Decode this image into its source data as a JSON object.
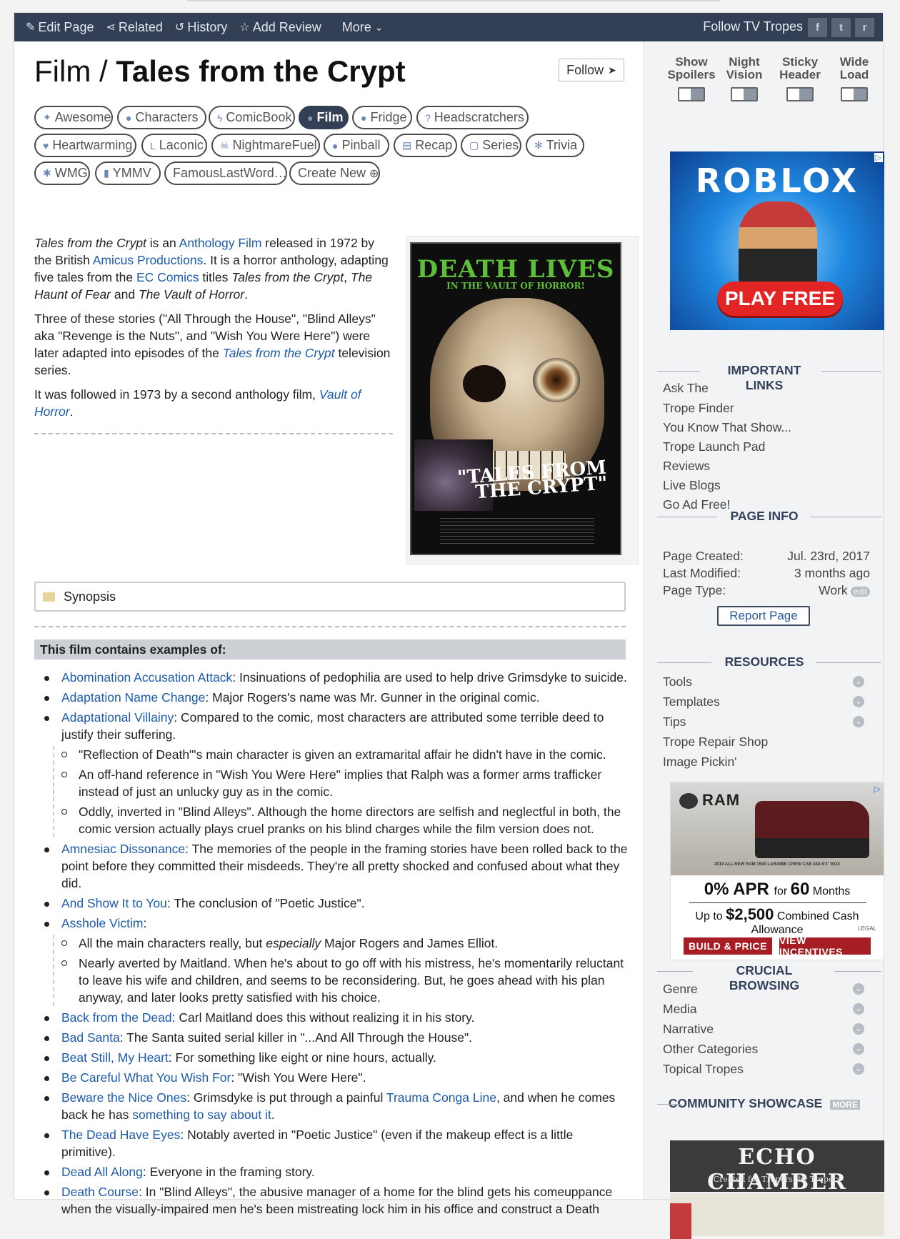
{
  "topbar": {
    "nav": [
      {
        "icon": "pencil-icon",
        "glyph": "✎",
        "label": "Edit Page"
      },
      {
        "icon": "share-icon",
        "glyph": "⋖",
        "label": "Related"
      },
      {
        "icon": "history-icon",
        "glyph": "↺",
        "label": "History"
      },
      {
        "icon": "star-icon",
        "glyph": "☆",
        "label": "Add Review"
      }
    ],
    "more_label": "More",
    "follow_label": "Follow TV Tropes",
    "social": [
      {
        "icon": "facebook-icon",
        "glyph": "f"
      },
      {
        "icon": "twitter-icon",
        "glyph": "t"
      },
      {
        "icon": "reddit-icon",
        "glyph": "r"
      }
    ]
  },
  "page": {
    "category": "Film",
    "separator": " / ",
    "title": "Tales from the Crypt",
    "follow_button": "Follow"
  },
  "tabs": [
    {
      "label": "Awesome",
      "glyph": "✦",
      "icon": "trophy-icon"
    },
    {
      "label": "Characters",
      "glyph": "●",
      "icon": "characters-icon"
    },
    {
      "label": "ComicBook",
      "glyph": "ϟ",
      "icon": "lightning-icon"
    },
    {
      "label": "Film",
      "glyph": "●",
      "icon": "film-icon",
      "active": true
    },
    {
      "label": "Fridge",
      "glyph": "●",
      "icon": "lightbulb-icon"
    },
    {
      "label": "Headscratchers",
      "glyph": "?",
      "icon": "question-icon"
    },
    {
      "label": "Heartwarming",
      "glyph": "♥",
      "icon": "heart-icon"
    },
    {
      "label": "Laconic",
      "glyph": "L",
      "icon": "laconic-icon"
    },
    {
      "label": "NightmareFuel",
      "glyph": "☠",
      "icon": "skull-icon"
    },
    {
      "label": "Pinball",
      "glyph": "●",
      "icon": "pinball-icon"
    },
    {
      "label": "Recap",
      "glyph": "▤",
      "icon": "recap-icon"
    },
    {
      "label": "Series",
      "glyph": "▢",
      "icon": "tv-icon"
    },
    {
      "label": "Trivia",
      "glyph": "✻",
      "icon": "trivia-icon"
    },
    {
      "label": "WMG",
      "glyph": "✱",
      "icon": "wmg-icon"
    },
    {
      "label": "YMMV",
      "glyph": "▮",
      "icon": "ymmv-icon"
    },
    {
      "label": "FamousLastWord…",
      "glyph": "",
      "icon": ""
    },
    {
      "label": "Create New",
      "glyph": "⊕",
      "icon": "plus-circle-icon"
    }
  ],
  "intro": {
    "p1": {
      "a": "Tales from the Crypt",
      "b": " is an ",
      "c": "Anthology Film",
      "d": " released in 1972 by the British ",
      "e": "Amicus Productions",
      "f": ". It is a horror anthology, adapting five tales from the ",
      "g": "EC Comics",
      "h": " titles ",
      "i": "Tales from the Crypt",
      "j": ", ",
      "k": "The Haunt of Fear",
      "l": " and ",
      "m": "The Vault of Horror",
      "n": "."
    },
    "p2": {
      "a": "Three of these stories (\"All Through the House\", \"Blind Alleys\" aka \"Revenge is the Nuts\", and \"Wish You Were Here\") were later adapted into episodes of the ",
      "b": "Tales from the Crypt",
      "c": " television series."
    },
    "p3": {
      "a": "It was followed in 1973 by a second anthology film, ",
      "b": "Vault of Horror",
      "c": "."
    }
  },
  "poster": {
    "headline": "DEATH LIVES",
    "subline": "IN THE VAULT OF HORROR!",
    "title_art": "\"TALES FROM THE CRYPT\""
  },
  "synopsis_label": "Synopsis",
  "examples_heading": "This film contains examples of:",
  "tropes": [
    {
      "link": "Abomination Accusation Attack",
      "text": ": Insinuations of pedophilia are used to help drive Grimsdyke to suicide."
    },
    {
      "link": "Adaptation Name Change",
      "text": ": Major Rogers's name was Mr. Gunner in the original comic."
    },
    {
      "link": "Adaptational Villainy",
      "text": ": Compared to the comic, most characters are attributed some terrible deed to justify their suffering.",
      "sub": [
        "\"Reflection of Death\"'s main character is given an extramarital affair he didn't have in the comic.",
        "An off-hand reference in \"Wish You Were Here\" implies that Ralph was a former arms trafficker instead of just an unlucky guy as in the comic.",
        "Oddly, inverted in \"Blind Alleys\". Although the home directors are selfish and neglectful in both, the comic version actually plays cruel pranks on his blind charges while the film version does not."
      ]
    },
    {
      "link": "Amnesiac Dissonance",
      "text": ": The memories of the people in the framing stories have been rolled back to the point before they committed their misdeeds. They're all pretty shocked and confused about what they did."
    },
    {
      "link": "And Show It to You",
      "text": ": The conclusion of \"Poetic Justice\"."
    },
    {
      "link": "Asshole Victim",
      "text": ":",
      "sub_rich": [
        {
          "a": "All the main characters really, but ",
          "em": "especially",
          "b": " Major Rogers and James Elliot."
        },
        {
          "a": "Nearly averted by Maitland. When he's about to go off with his mistress, he's momentarily reluctant to leave his wife and children, and seems to be reconsidering. But, he goes ahead with his plan anyway, and later looks pretty satisfied with his choice.",
          "em": "",
          "b": ""
        }
      ]
    },
    {
      "link": "Back from the Dead",
      "text": ": Carl Maitland does this without realizing it in his story."
    },
    {
      "link": "Bad Santa",
      "text": ": The Santa suited serial killer in \"...And All Through the House\"."
    },
    {
      "link": "Beat Still, My Heart",
      "text": ": For something like eight or nine hours, actually."
    },
    {
      "link": "Be Careful What You Wish For",
      "text": ": \"Wish You Were Here\"."
    },
    {
      "link": "Beware the Nice Ones",
      "text": ": Grimsdyke is put through a painful ",
      "link2": "Trauma Conga Line",
      "text2": ", and when he comes back he has ",
      "link3": "something to say about it",
      "text3": "."
    },
    {
      "link": "The Dead Have Eyes",
      "text": ": Notably averted in \"Poetic Justice\" (even if the makeup effect is a little primitive)."
    },
    {
      "link": "Dead All Along",
      "text": ": Everyone in the framing story."
    },
    {
      "link": "Death Course",
      "text": ": In \"Blind Alleys\", the abusive manager of a home for the blind gets his comeuppance when the visually-impaired men he's been mistreating lock him in his office and construct a Death"
    }
  ],
  "sidebar": {
    "toggles": [
      {
        "line1": "Show",
        "line2": "Spoilers"
      },
      {
        "line1": "Night",
        "line2": "Vision"
      },
      {
        "line1": "Sticky",
        "line2": "Header"
      },
      {
        "line1": "Wide",
        "line2": "Load"
      }
    ],
    "ad1": {
      "logo": "ROBLOX",
      "cta": "PLAY FREE",
      "badge": "▷"
    },
    "important": {
      "heading1": "IMPORTANT",
      "heading2": "LINKS",
      "items": [
        "Ask The",
        "Trope Finder",
        "You Know That Show...",
        "Trope Launch Pad",
        "Reviews",
        "Live Blogs",
        "Go Ad Free!"
      ]
    },
    "pageinfo": {
      "heading": "PAGE INFO",
      "rows": [
        {
          "k": "Page Created:",
          "v": "Jul. 23rd, 2017"
        },
        {
          "k": "Last Modified:",
          "v": "3 months ago"
        },
        {
          "k": "Page Type:",
          "v": "Work"
        }
      ],
      "edit": "edit",
      "report": "Report Page"
    },
    "resources": {
      "heading": "RESOURCES",
      "items": [
        {
          "label": "Tools",
          "chev": true
        },
        {
          "label": "Templates",
          "chev": true
        },
        {
          "label": "Tips",
          "chev": true
        },
        {
          "label": "Trope Repair Shop",
          "chev": false
        },
        {
          "label": "Image Pickin'",
          "chev": false
        }
      ]
    },
    "ad2": {
      "brand": "RAM",
      "caption": "2019 ALL-NEW RAM 1500 LARAMIE CREW CAB 4X4 6'4\" BOX",
      "apr1": "0",
      "apr2": "% APR ",
      "apr3": "for ",
      "apr4": "60",
      "apr5": " Months",
      "cash1": "Up to ",
      "cash2": "$2,500",
      "cash3": " Combined Cash Allowance",
      "legal": "LEGAL",
      "btn1": "BUILD & PRICE",
      "btn2": "VIEW INCENTIVES",
      "badge": "▷"
    },
    "crucial": {
      "heading1": "CRUCIAL",
      "heading2": "BROWSING",
      "items": [
        "Genre",
        "Media",
        "Narrative",
        "Other Categories",
        "Topical Tropes"
      ]
    },
    "showcase": {
      "heading": "COMMUNITY SHOWCASE",
      "more": "MORE",
      "title": "ECHO CHAMBER",
      "tagline": "Created for Tropers, by Tropers"
    }
  }
}
